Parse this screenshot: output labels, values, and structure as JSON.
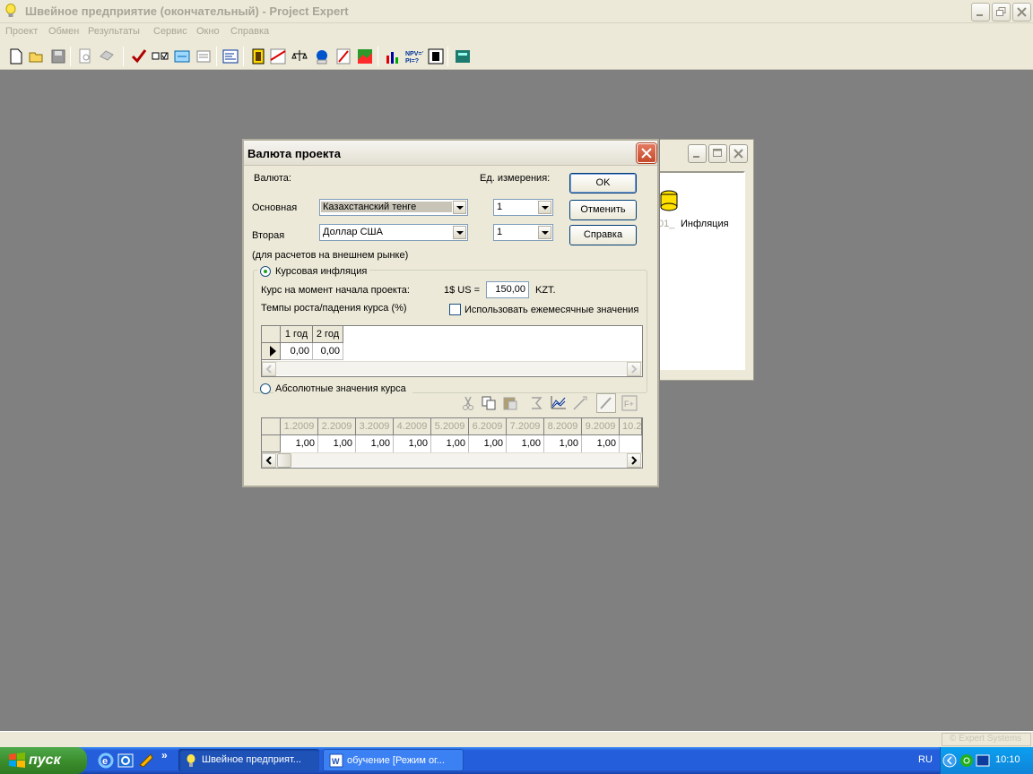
{
  "app": {
    "title": "Швейное предприятие (окончательный) - Project Expert",
    "menu": [
      "Проект",
      "Обмен",
      "Результаты",
      "Сервис",
      "Окно",
      "Справка"
    ]
  },
  "toolbar_icons": [
    "new-file-icon",
    "open-folder-icon",
    "save-icon",
    "print-preview-icon",
    "print-icon",
    "check-icon",
    "checklist-icon",
    "exchange-icon",
    "notes-icon",
    "list-icon",
    "report-icon",
    "cashflow-icon",
    "balance-icon",
    "details-icon",
    "chart-report-icon",
    "chart-area-icon",
    "bar-chart-icon",
    "npv-icon",
    "analysis-icon",
    "calculator-icon"
  ],
  "bg_window": {
    "label_partial": "01_",
    "label": "Инфляция"
  },
  "dialog": {
    "title": "Валюта проекта",
    "currency_label": "Валюта:",
    "unit_label": "Ед. измерения:",
    "primary_label": "Основная",
    "primary_value": "Казахстанский тенге",
    "primary_unit": "1",
    "secondary_label": "Вторая",
    "secondary_value": "Доллар США",
    "secondary_unit": "1",
    "secondary_note": "(для расчетов на внешнем рынке)",
    "buttons": {
      "ok": "OK",
      "cancel": "Отменить",
      "help": "Справка"
    },
    "rate_inflation": {
      "label": "Курсовая инфляция",
      "selected": true,
      "start_rate_label": "Курс на момент начала проекта:",
      "rate_prefix": "1$ US =",
      "rate_value": "150,00",
      "rate_suffix": "KZT.",
      "growth_label": "Темпы роста/падения курса (%)",
      "monthly_checkbox_label": "Использовать ежемесячные значения",
      "monthly_checked": false,
      "columns": [
        "1 год",
        "2 год"
      ],
      "values": [
        "0,00",
        "0,00"
      ]
    },
    "absolute_values": {
      "label": "Абсолютные значения курса",
      "selected": false,
      "columns": [
        "1.2009",
        "2.2009",
        "3.2009",
        "4.2009",
        "5.2009",
        "6.2009",
        "7.2009",
        "8.2009",
        "9.2009",
        "10.2"
      ],
      "values": [
        "1,00",
        "1,00",
        "1,00",
        "1,00",
        "1,00",
        "1,00",
        "1,00",
        "1,00",
        "1,00",
        ""
      ]
    }
  },
  "statusbar": {
    "copyright": "© Expert Systems"
  },
  "taskbar": {
    "start": "пуск",
    "tasks": [
      "Швейное предприят...",
      "обучение [Режим ог..."
    ],
    "lang": "RU",
    "clock": "10:10"
  },
  "colors": {
    "workspace": "#808080",
    "window": "#ece9d8",
    "taskbar": "#245edb",
    "start": "#3c8f2d"
  }
}
